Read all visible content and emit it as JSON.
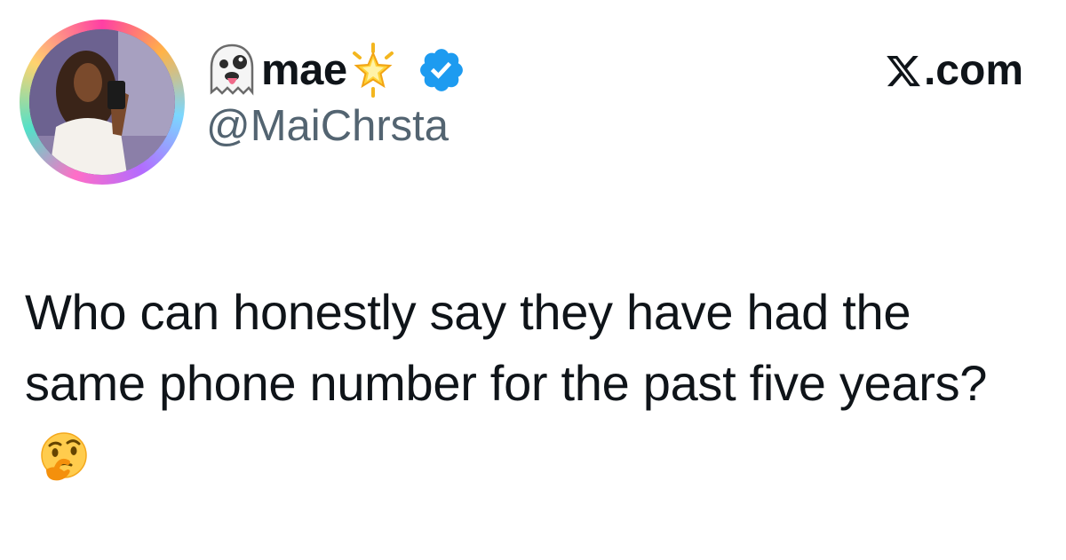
{
  "author": {
    "display_name": "mae",
    "handle": "@MaiChrsta",
    "name_emojis": [
      "ghost-tongue-emoji",
      "glowing-star-emoji"
    ],
    "verified": true
  },
  "site": {
    "label": ".com",
    "logo": "x-logo"
  },
  "tweet": {
    "text": "Who can honestly say they have had the same phone number for the past five years?",
    "trailing_emoji": "thinking-face-emoji"
  },
  "colors": {
    "text": "#0f1419",
    "handle": "#536471",
    "verified_badge": "#1d9bf0",
    "background": "#ffffff"
  }
}
